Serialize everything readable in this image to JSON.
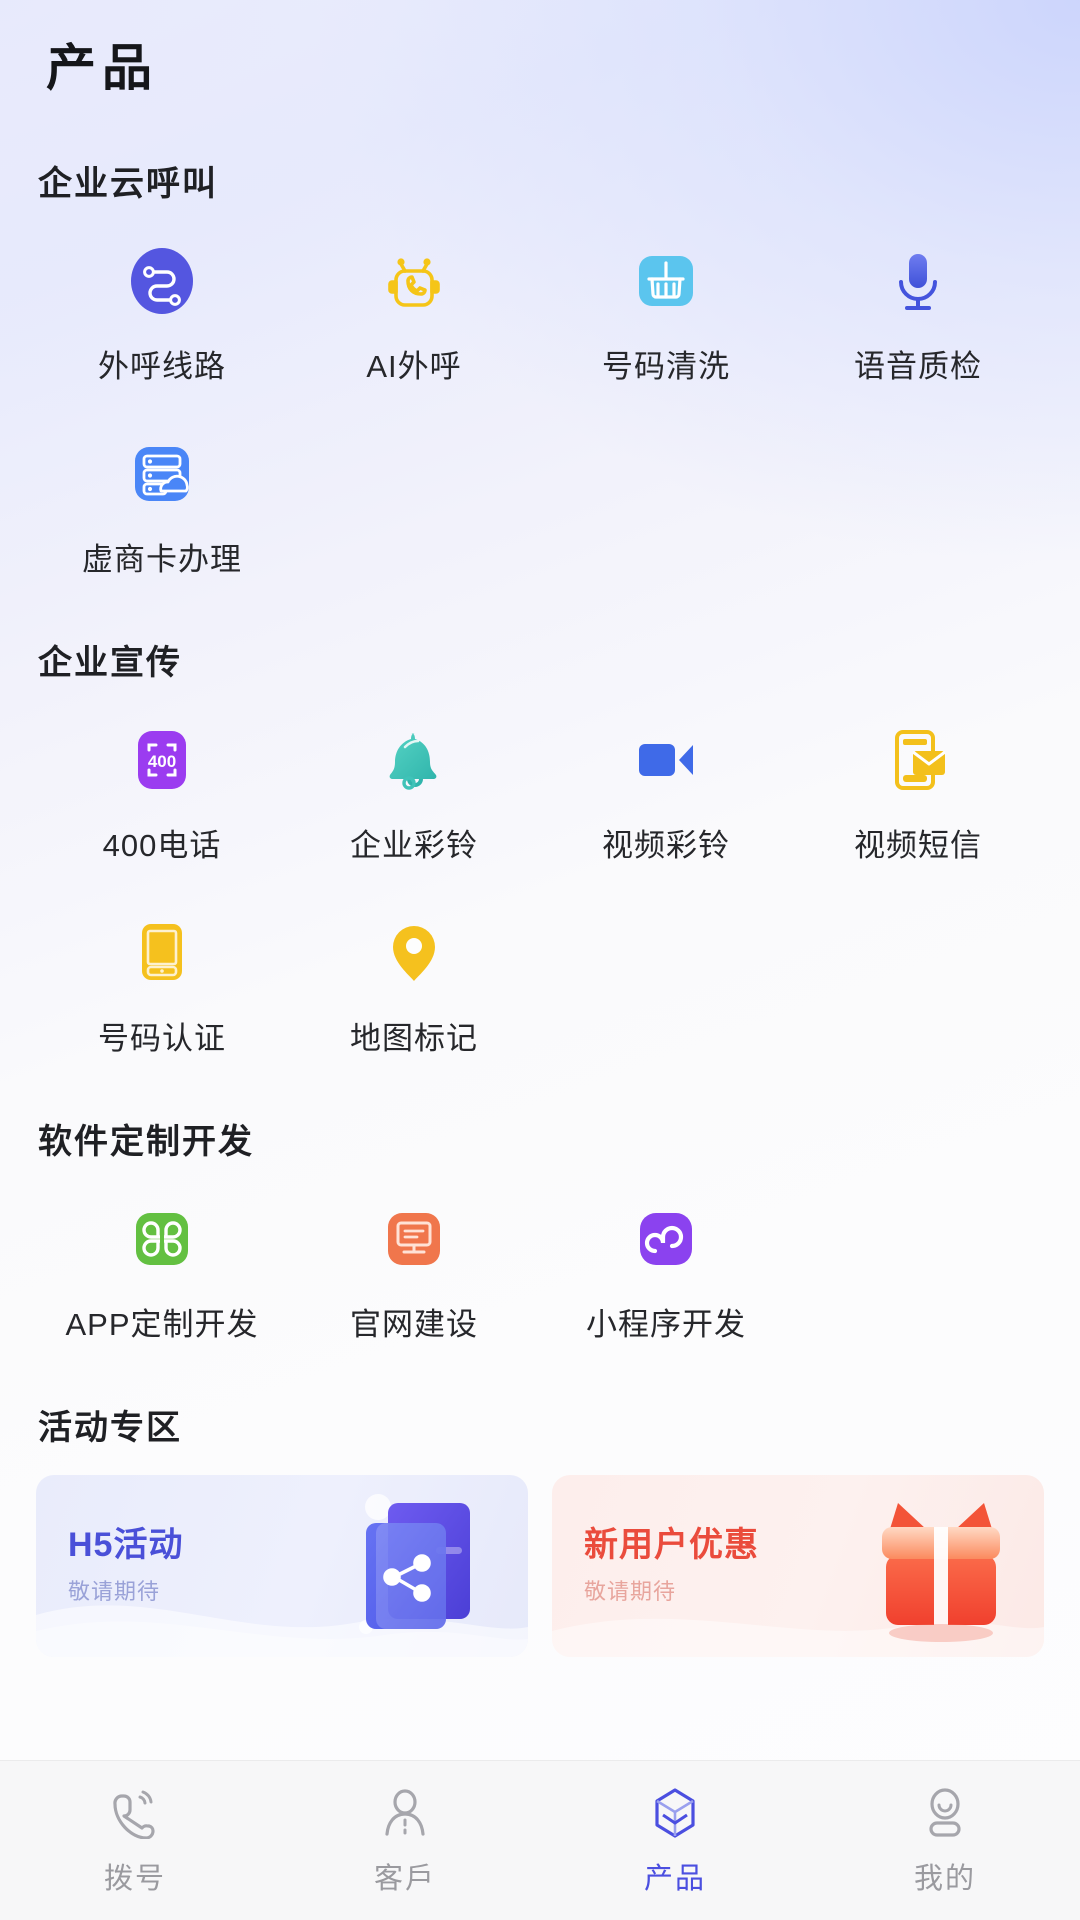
{
  "page": {
    "title": "产品"
  },
  "sections": [
    {
      "id": "cloud-call",
      "title": "企业云呼叫",
      "items": [
        {
          "label": "外呼线路",
          "icon": "route-circle-icon",
          "color": "#5456e0"
        },
        {
          "label": "AI外呼",
          "icon": "robot-phone-icon",
          "color": "#f5c518"
        },
        {
          "label": "号码清洗",
          "icon": "broom-icon",
          "color": "#5bc5ee"
        },
        {
          "label": "语音质检",
          "icon": "microphone-icon",
          "color": "#4f6fe6"
        },
        {
          "label": "虚商卡办理",
          "icon": "server-cloud-icon",
          "color": "#4a86f7"
        }
      ]
    },
    {
      "id": "promotion",
      "title": "企业宣传",
      "items": [
        {
          "label": "400电话",
          "icon": "phone-400-icon",
          "color": "#9b3cf0",
          "badge": "400"
        },
        {
          "label": "企业彩铃",
          "icon": "bell-icon",
          "color": "#3fc3b8"
        },
        {
          "label": "视频彩铃",
          "icon": "video-camera-icon",
          "color": "#3f6ae8"
        },
        {
          "label": "视频短信",
          "icon": "phone-envelope-icon",
          "color": "#f3c01b"
        },
        {
          "label": "号码认证",
          "icon": "mobile-verify-icon",
          "color": "#f5c11e"
        },
        {
          "label": "地图标记",
          "icon": "map-pin-icon",
          "color": "#f5c11e"
        }
      ]
    },
    {
      "id": "software",
      "title": "软件定制开发",
      "items": [
        {
          "label": "APP定制开发",
          "icon": "app-grid-icon",
          "color": "#63c041"
        },
        {
          "label": "官网建设",
          "icon": "monitor-icon",
          "color": "#f0764c"
        },
        {
          "label": "小程序开发",
          "icon": "miniprogram-icon",
          "color": "#8b42ef"
        }
      ]
    }
  ],
  "activity": {
    "title": "活动专区",
    "banners": [
      {
        "title": "H5活动",
        "subtitle": "敬请期待",
        "art": "share-document-icon",
        "accent": "#4a50d8"
      },
      {
        "title": "新用户优惠",
        "subtitle": "敬请期待",
        "art": "gift-box-icon",
        "accent": "#ea4b3c"
      }
    ]
  },
  "tabbar": {
    "active_index": 2,
    "active_color": "#4b4fe0",
    "inactive_color": "#9a9a9f",
    "tabs": [
      {
        "label": "拨号",
        "icon": "phone-call-icon"
      },
      {
        "label": "客戶",
        "icon": "person-icon"
      },
      {
        "label": "产品",
        "icon": "cube-icon"
      },
      {
        "label": "我的",
        "icon": "user-profile-icon"
      }
    ]
  }
}
